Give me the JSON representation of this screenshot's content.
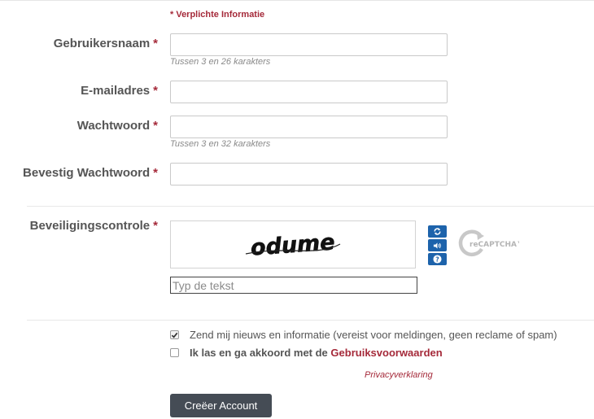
{
  "form": {
    "required_note": "* Verplichte Informatie",
    "required_star": "*",
    "fields": {
      "username": {
        "label": "Gebruikersnaam",
        "value": "",
        "hint": "Tussen 3 en 26 karakters"
      },
      "email": {
        "label": "E-mailadres",
        "value": ""
      },
      "password": {
        "label": "Wachtwoord",
        "value": "",
        "hint": "Tussen 3 en 32 karakters"
      },
      "confirm_password": {
        "label": "Bevestig Wachtwoord",
        "value": ""
      }
    },
    "captcha": {
      "label": "Beveiligingscontrole",
      "challenge_text": "odume",
      "input_placeholder": "Typ de tekst",
      "input_value": "",
      "buttons": [
        "refresh-icon",
        "audio-icon",
        "help-icon"
      ],
      "logo_text": "reCAPTCHA™"
    },
    "newsletter": {
      "checked": true,
      "label": "Zend mij nieuws en informatie (vereist voor meldingen, geen reclame of spam)"
    },
    "terms": {
      "checked": false,
      "label": "Ik las en ga akkoord met de",
      "link": "Gebruiksvoorwaarden"
    },
    "privacy_link": "Privacyverklaring",
    "submit_label": "Creëer Account"
  },
  "colors": {
    "accent": "#a52a3a",
    "captcha_button": "#1d63ab",
    "submit_bg": "#454c55",
    "label_text": "#555555"
  }
}
